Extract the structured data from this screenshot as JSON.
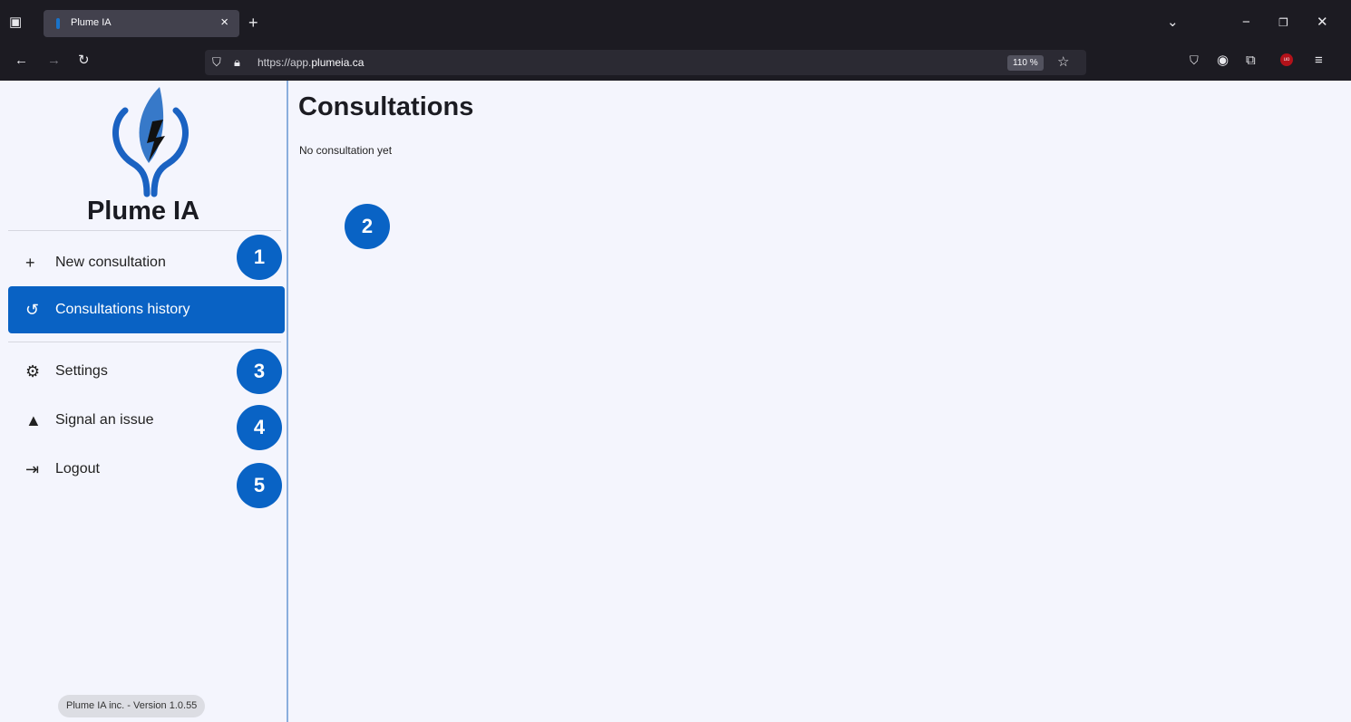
{
  "browser": {
    "tab_title": "Plume IA",
    "url_prefix": "https://app.",
    "url_domain": "plumeia.ca",
    "zoom": "110 %"
  },
  "sidebar": {
    "brand": "Plume IA",
    "items": [
      {
        "label": "New consultation",
        "icon": "plus-icon"
      },
      {
        "label": "Consultations history",
        "icon": "history-icon"
      },
      {
        "label": "Settings",
        "icon": "gear-icon"
      },
      {
        "label": "Signal an issue",
        "icon": "warning-icon"
      },
      {
        "label": "Logout",
        "icon": "logout-icon"
      }
    ],
    "version": "Plume IA inc. - Version 1.0.55"
  },
  "main": {
    "title": "Consultations",
    "empty_message": "No consultation yet"
  },
  "annotations": [
    "1",
    "2",
    "3",
    "4",
    "5"
  ],
  "colors": {
    "accent": "#0962c4",
    "background": "#f4f5fd",
    "browser_chrome": "#1c1b22"
  }
}
